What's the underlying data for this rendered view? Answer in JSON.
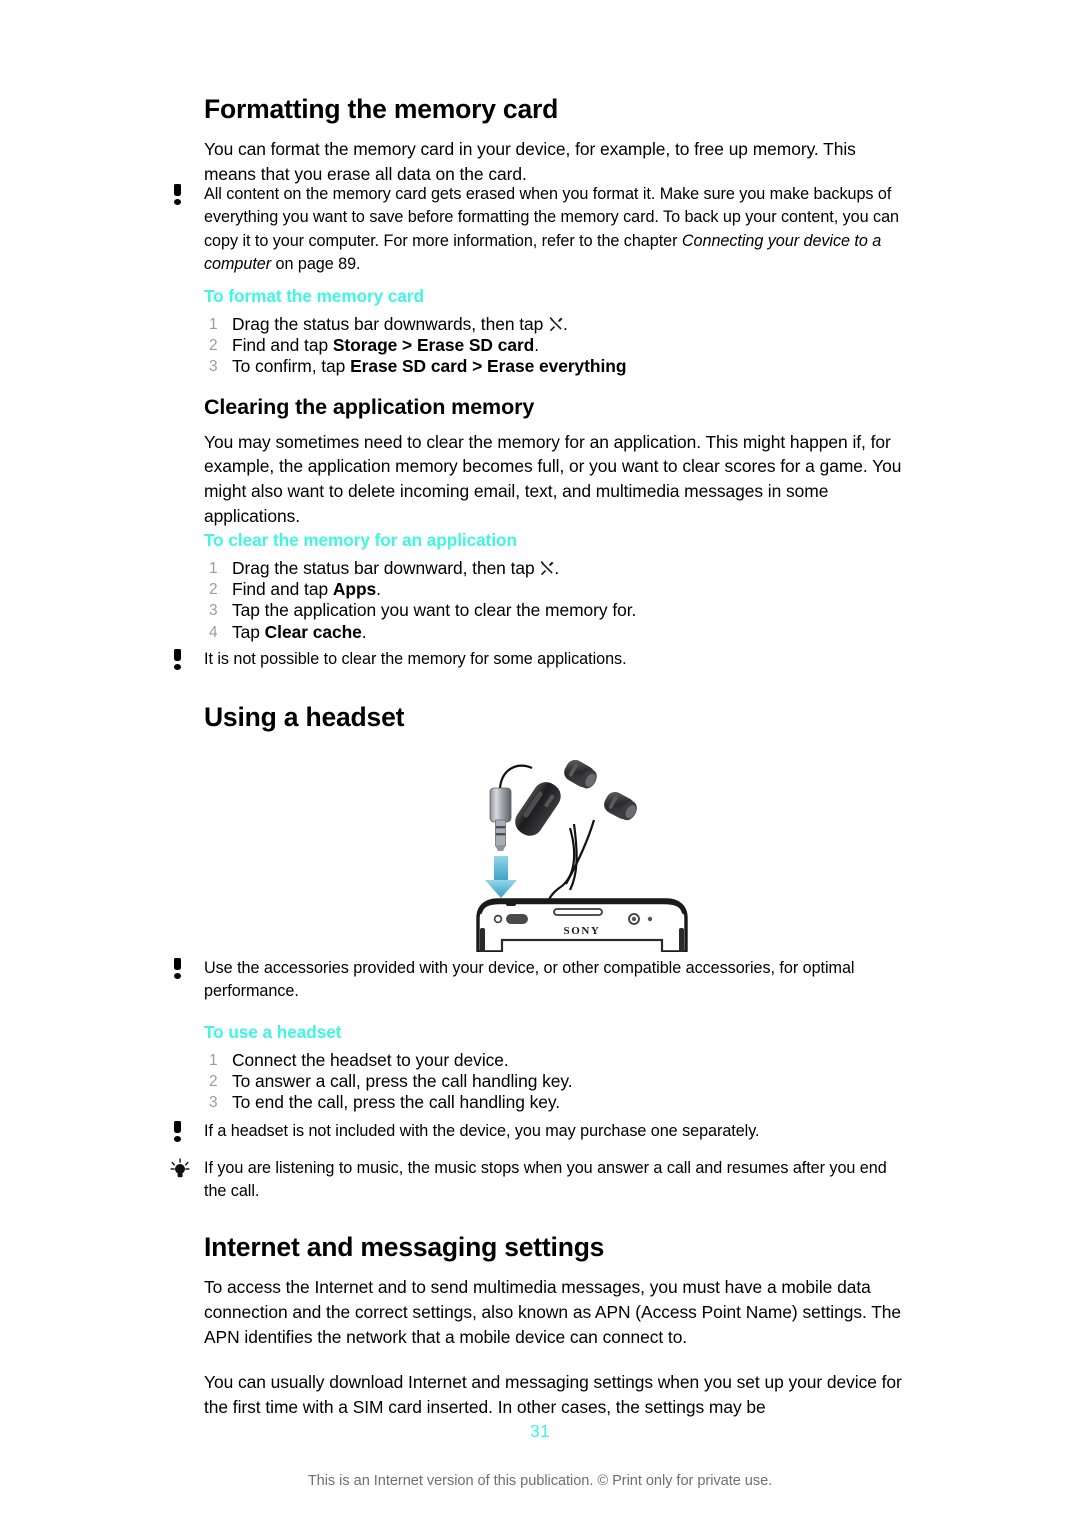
{
  "document": {
    "page_number": "31",
    "footer_note": "This is an Internet version of this publication. © Print only for private use.",
    "accent_color": "#3ff6e0",
    "step_number_color": "#9b9b9b",
    "arrow_color": "#5bb8d8"
  },
  "sections": {
    "formatting_memory_card": {
      "title": "Formatting the memory card",
      "intro": "You can format the memory card in your device, for example, to free up memory. This means that you erase all data on the card.",
      "note_icon": "exclamation-icon",
      "note_part1": "All content on the memory card gets erased when you format it. Make sure you make backups of everything you want to save before formatting the memory card. To back up your content, you can copy it to your computer. For more information, refer to the chapter ",
      "note_italic": "Connecting your device to a computer",
      "note_part2": " on page 89.",
      "procedure": {
        "heading": "To format the memory card",
        "steps": [
          {
            "prefix": "Drag the status bar downwards, then tap ",
            "icon": "settings-tools-icon",
            "suffix": "."
          },
          {
            "prefix": "Find and tap ",
            "bold": "Storage > Erase SD card",
            "suffix": "."
          },
          {
            "prefix": "To confirm, tap ",
            "bold": "Erase SD card > Erase everything",
            "suffix": ""
          }
        ]
      }
    },
    "clearing_application_memory": {
      "title": "Clearing the application memory",
      "intro": "You may sometimes need to clear the memory for an application. This might happen if, for example, the application memory becomes full, or you want to clear scores for a game. You might also want to delete incoming email, text, and multimedia messages in some applications.",
      "procedure": {
        "heading": "To clear the memory for an application",
        "steps": [
          {
            "prefix": "Drag the status bar downward, then tap ",
            "icon": "settings-tools-icon",
            "suffix": "."
          },
          {
            "prefix": "Find and tap ",
            "bold": "Apps",
            "suffix": "."
          },
          {
            "prefix": "Tap the application you want to clear the memory for.",
            "bold": "",
            "suffix": ""
          },
          {
            "prefix": "Tap ",
            "bold": "Clear cache",
            "suffix": "."
          }
        ]
      },
      "note_icon": "exclamation-icon",
      "note": "It is not possible to clear the memory for some applications."
    },
    "using_a_headset": {
      "title": "Using a headset",
      "illustration": {
        "name": "headset-to-phone-illustration",
        "device_brand": "SONY",
        "arrow": "down-arrow",
        "parts": [
          "earbuds",
          "inline-remote",
          "headphone-jack",
          "phone-top"
        ]
      },
      "note_icon": "exclamation-icon",
      "note_top": "Use the accessories provided with your device, or other compatible accessories, for optimal performance.",
      "procedure": {
        "heading": "To use a headset",
        "steps": [
          {
            "prefix": "Connect the headset to your device.",
            "bold": "",
            "suffix": ""
          },
          {
            "prefix": "To answer a call, press the call handling key.",
            "bold": "",
            "suffix": ""
          },
          {
            "prefix": "To end the call, press the call handling key.",
            "bold": "",
            "suffix": ""
          }
        ]
      },
      "note_bottom": "If a headset is not included with the device, you may purchase one separately.",
      "tip_icon": "lightbulb-icon",
      "tip": "If you are listening to music, the music stops when you answer a call and resumes after you end the call."
    },
    "internet_and_messaging_settings": {
      "title": "Internet and messaging settings",
      "paragraph1": "To access the Internet and to send multimedia messages, you must have a mobile data connection and the correct settings, also known as APN (Access Point Name) settings. The APN identifies the network that a mobile device can connect to.",
      "paragraph2": "You can usually download Internet and messaging settings when you set up your device for the first time with a SIM card inserted. In other cases, the settings may be"
    }
  }
}
